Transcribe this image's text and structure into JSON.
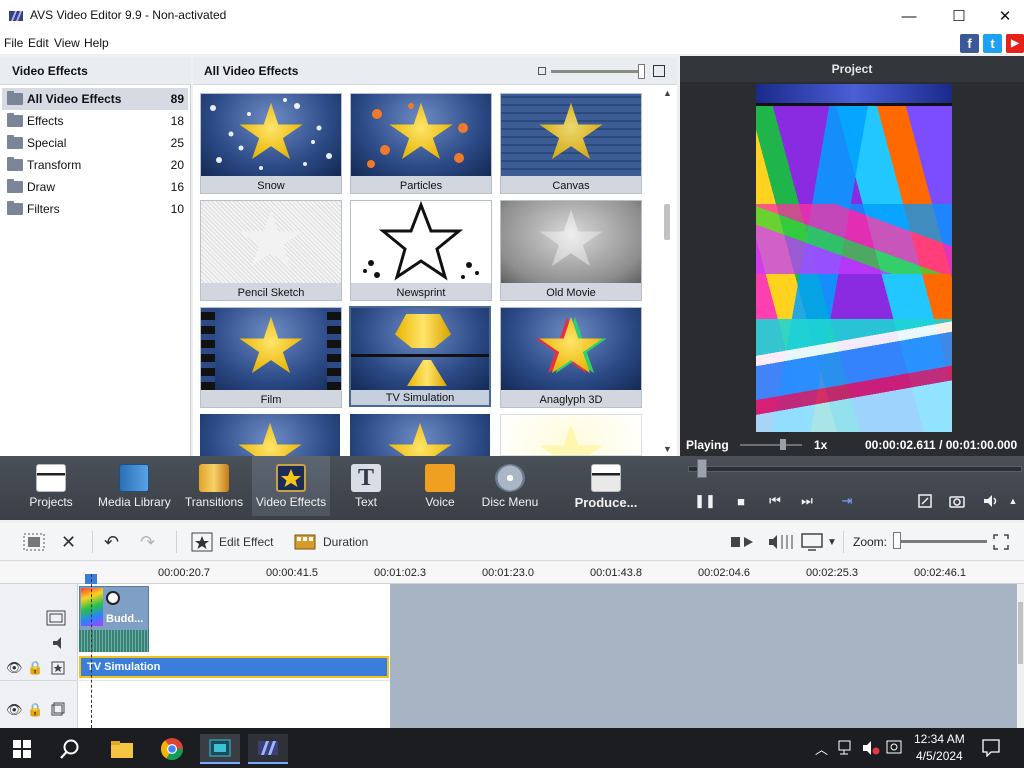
{
  "window": {
    "title": "AVS Video Editor 9.9 - Non-activated",
    "minimize_glyph": "—",
    "maximize_glyph": "☐",
    "close_glyph": "✕"
  },
  "menu": [
    "File",
    "Edit",
    "View",
    "Help"
  ],
  "social": {
    "facebook": "f",
    "twitter": "t",
    "youtube": "▶"
  },
  "sidebar": {
    "title": "Video Effects",
    "categories": [
      {
        "label": "All Video Effects",
        "count": "89",
        "selected": true
      },
      {
        "label": "Effects",
        "count": "18"
      },
      {
        "label": "Special",
        "count": "25"
      },
      {
        "label": "Transform",
        "count": "20"
      },
      {
        "label": "Draw",
        "count": "16"
      },
      {
        "label": "Filters",
        "count": "10"
      }
    ]
  },
  "gallery": {
    "title": "All Video Effects",
    "scroll_up": "▲",
    "scroll_down": "▼",
    "tiles": [
      {
        "label": "Snow"
      },
      {
        "label": "Particles"
      },
      {
        "label": "Canvas"
      },
      {
        "label": "Pencil Sketch"
      },
      {
        "label": "Newsprint"
      },
      {
        "label": "Old Movie"
      },
      {
        "label": "Film"
      },
      {
        "label": "TV Simulation",
        "selected": true
      },
      {
        "label": "Anaglyph 3D"
      }
    ]
  },
  "preview": {
    "title": "Project",
    "status": "Playing",
    "speed": "1x",
    "timecode": "00:00:02.611 / 00:01:00.000"
  },
  "toolbar": {
    "items": [
      {
        "label": "Projects"
      },
      {
        "label": "Media Library"
      },
      {
        "label": "Transitions"
      },
      {
        "label": "Video Effects",
        "active": true
      },
      {
        "label": "Text"
      },
      {
        "label": "Voice"
      },
      {
        "label": "Disc Menu"
      },
      {
        "label": "Produce..."
      }
    ],
    "text_glyph": "T"
  },
  "player_controls": {
    "pause": "❚❚",
    "stop": "■",
    "prev": "⏮",
    "next": "⏭",
    "mark": "⇥"
  },
  "timeline_toolbar": {
    "edit_effect": "Edit Effect",
    "duration": "Duration",
    "zoom": "Zoom:"
  },
  "ruler": {
    "ticks": [
      "00:00:20.7",
      "00:00:41.5",
      "00:01:02.3",
      "00:01:23.0",
      "00:01:43.8",
      "00:02:04.6",
      "00:02:25.3",
      "00:02:46.1"
    ]
  },
  "timeline": {
    "video_clip_label": "Budd...",
    "effect_clip_label": "TV Simulation"
  },
  "taskbar": {
    "time": "12:34 AM",
    "date": "4/5/2024"
  },
  "colors": {
    "accent": "#3a7ddb",
    "toolbar_bg": "#3b4047",
    "timeline_empty": "#a7b4c3"
  }
}
